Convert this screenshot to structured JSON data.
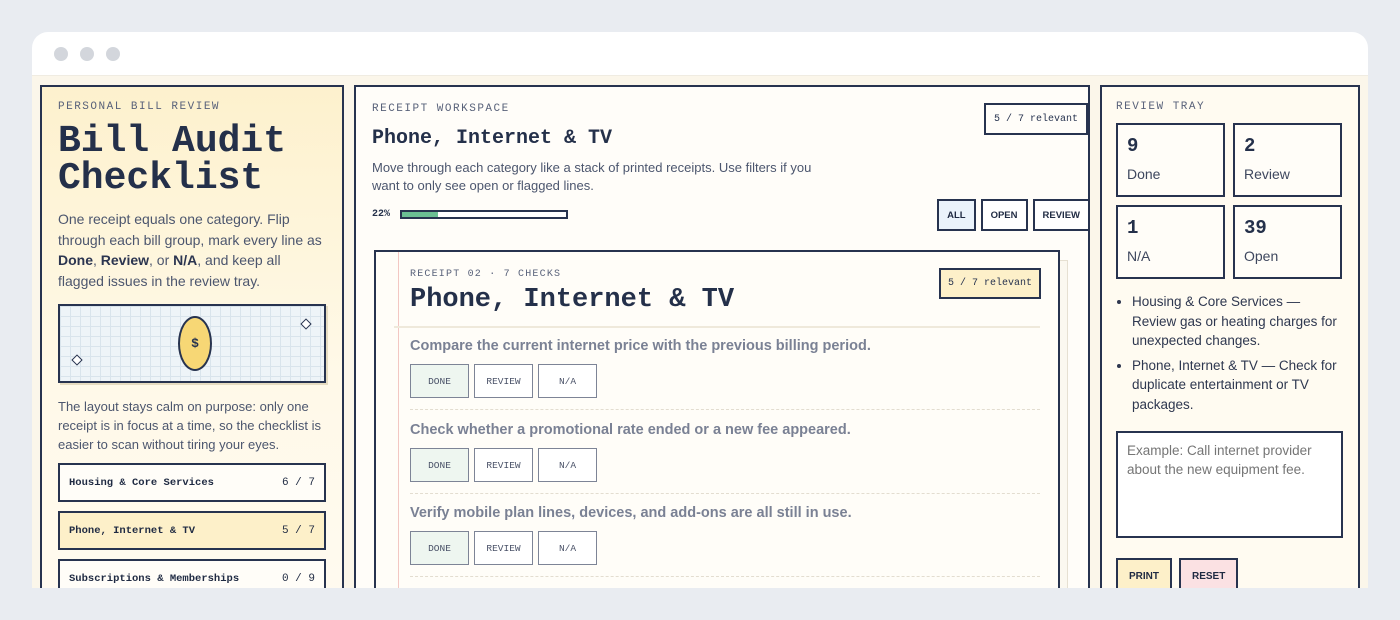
{
  "left": {
    "eyebrow": "PERSONAL BILL REVIEW",
    "title_line1": "Bill Audit",
    "title_line2": "Checklist",
    "intro_prefix": "One receipt equals one category. Flip through each bill group, mark every line as ",
    "intro_done": "Done",
    "intro_sep1": ", ",
    "intro_review": "Review",
    "intro_sep2": ", or ",
    "intro_na": "N/A",
    "intro_suffix": ", and keep all flagged issues in the review tray.",
    "coin_symbol": "$",
    "note": "The layout stays calm on purpose: only one receipt is in focus at a time, so the checklist is easier to scan without tiring your eyes.",
    "categories": [
      {
        "name": "Housing & Core Services",
        "count": "6 / 7"
      },
      {
        "name": "Phone, Internet & TV",
        "count": "5 / 7"
      },
      {
        "name": "Subscriptions & Memberships",
        "count": "0 / 9"
      }
    ]
  },
  "workspace": {
    "eyebrow": "RECEIPT WORKSPACE",
    "title": "Phone, Internet & TV",
    "description": "Move through each category like a stack of printed receipts. Use filters if you want to only see open or flagged lines.",
    "relevant_badge": "5 / 7 relevant",
    "progress_label": "22%",
    "progress_value": 0.22,
    "filters": [
      "ALL",
      "OPEN",
      "REVIEW"
    ],
    "selected_filter": "ALL"
  },
  "receipt": {
    "eyebrow": "RECEIPT 02 · 7 CHECKS",
    "title": "Phone, Internet & TV",
    "relevant_badge": "5 / 7 relevant",
    "items": [
      {
        "text": "Compare the current internet price with the previous billing period."
      },
      {
        "text": "Check whether a promotional rate ended or a new fee appeared."
      },
      {
        "text": "Verify mobile plan lines, devices, and add-ons are all still in use."
      }
    ],
    "button_labels": {
      "done": "DONE",
      "review": "REVIEW",
      "na": "N/A"
    }
  },
  "tray": {
    "eyebrow": "REVIEW TRAY",
    "stats": [
      {
        "num": "9",
        "label": "Done"
      },
      {
        "num": "2",
        "label": "Review"
      },
      {
        "num": "1",
        "label": "N/A"
      },
      {
        "num": "39",
        "label": "Open"
      }
    ],
    "flags": [
      "Housing & Core Services — Review gas or heating charges for unexpected changes.",
      "Phone, Internet & TV — Check for duplicate entertainment or TV packages."
    ],
    "notes_placeholder": "Example: Call internet provider about the new equipment fee.",
    "print_label": "PRINT",
    "reset_label": "RESET"
  }
}
